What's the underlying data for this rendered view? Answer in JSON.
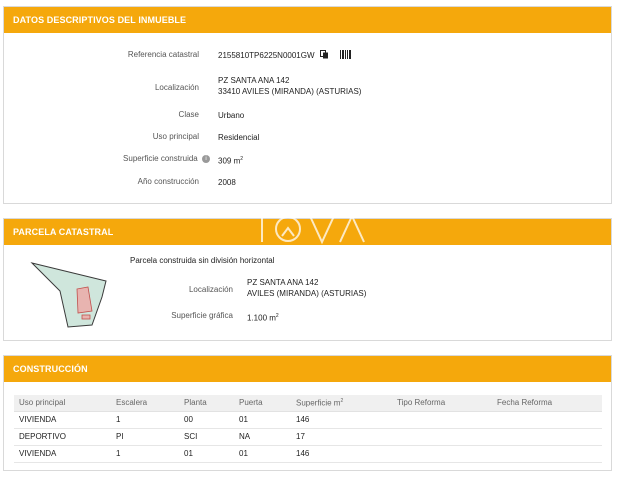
{
  "datos": {
    "header": "DATOS DESCRIPTIVOS DEL INMUEBLE",
    "referencia_label": "Referencia catastral",
    "referencia_value": "2155810TP6225N0001GW",
    "localizacion_label": "Localización",
    "localizacion_line1": "PZ SANTA ANA 142",
    "localizacion_line2": "33410 AVILES (MIRANDA) (ASTURIAS)",
    "clase_label": "Clase",
    "clase_value": "Urbano",
    "uso_label": "Uso principal",
    "uso_value": "Residencial",
    "superficie_label": "Superficie construida",
    "superficie_value": "309 m",
    "superficie_unit_sup": "2",
    "anio_label": "Año construcción",
    "anio_value": "2008",
    "icons": [
      "copy-icon",
      "barcode-icon",
      "info-icon"
    ]
  },
  "parcela": {
    "header": "PARCELA CATASTRAL",
    "title": "Parcela construida sin división horizontal",
    "localizacion_label": "Localización",
    "localizacion_line1": "PZ SANTA ANA 142",
    "localizacion_line2": "AVILES (MIRANDA) (ASTURIAS)",
    "superficie_label": "Superficie gráfica",
    "superficie_value": "1.100 m",
    "superficie_unit_sup": "2",
    "map_colors": {
      "fill": "#cfe6dc",
      "stroke": "#3a3a3a",
      "building": "#e8b4b0"
    }
  },
  "construccion": {
    "header": "CONSTRUCCIÓN",
    "columns": [
      "Uso principal",
      "Escalera",
      "Planta",
      "Puerta",
      "Superficie m",
      "Tipo Reforma",
      "Fecha Reforma"
    ],
    "superficie_sup": "2",
    "rows": [
      [
        "VIVIENDA",
        "1",
        "00",
        "01",
        "146",
        "",
        ""
      ],
      [
        "DEPORTIVO",
        "PI",
        "SCI",
        "NA",
        "17",
        "",
        ""
      ],
      [
        "VIVIENDA",
        "1",
        "01",
        "01",
        "146",
        "",
        ""
      ]
    ]
  },
  "colors": {
    "accent": "#f5a80c",
    "header_text": "#ffffff"
  }
}
